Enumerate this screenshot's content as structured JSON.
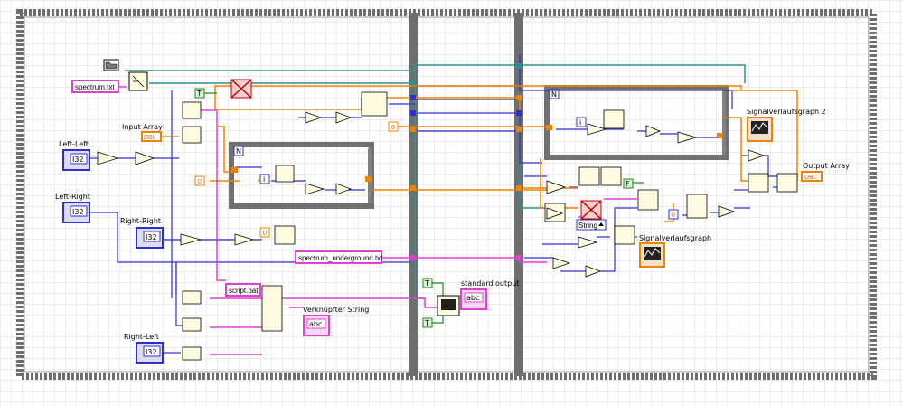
{
  "labels": {
    "left_left": "Left-Left",
    "left_right": "Left-Right",
    "right_right": "Right-Right",
    "right_left": "Right-Left",
    "input_array": "Input Array",
    "verknuepfter_string": "Verknüpfter String",
    "standard_output": "standard output",
    "signalverlaufsgraph2": "Signalverlaufsgraph 2",
    "signalverlaufsgraph": "Signalverlaufsgraph",
    "output_array": "Output Array"
  },
  "strings": {
    "spectrum_txt": "spectrum.txt",
    "spectrum_underground_txt": "spectrum_underground.txt",
    "script_bat": "script.bat",
    "string_type": "String"
  },
  "terminals": {
    "i32_badge": "I32",
    "dbl_badge": "DBL",
    "abc_badge": "abc",
    "loop_n": "N",
    "loop_i": "i",
    "bool_true": "T",
    "bool_false": "F"
  },
  "constants": {
    "zero": "0"
  },
  "colors": {
    "background_grid": "#d8d8d8",
    "structure_frame": "#6e6e6e",
    "wire_numeric_orange": "#f08200",
    "wire_double_blue": "#2f2fd0",
    "wire_string_pink": "#e040d0",
    "wire_error_teal": "#2f8f8f",
    "wire_bool_green": "#1a8a1a"
  }
}
